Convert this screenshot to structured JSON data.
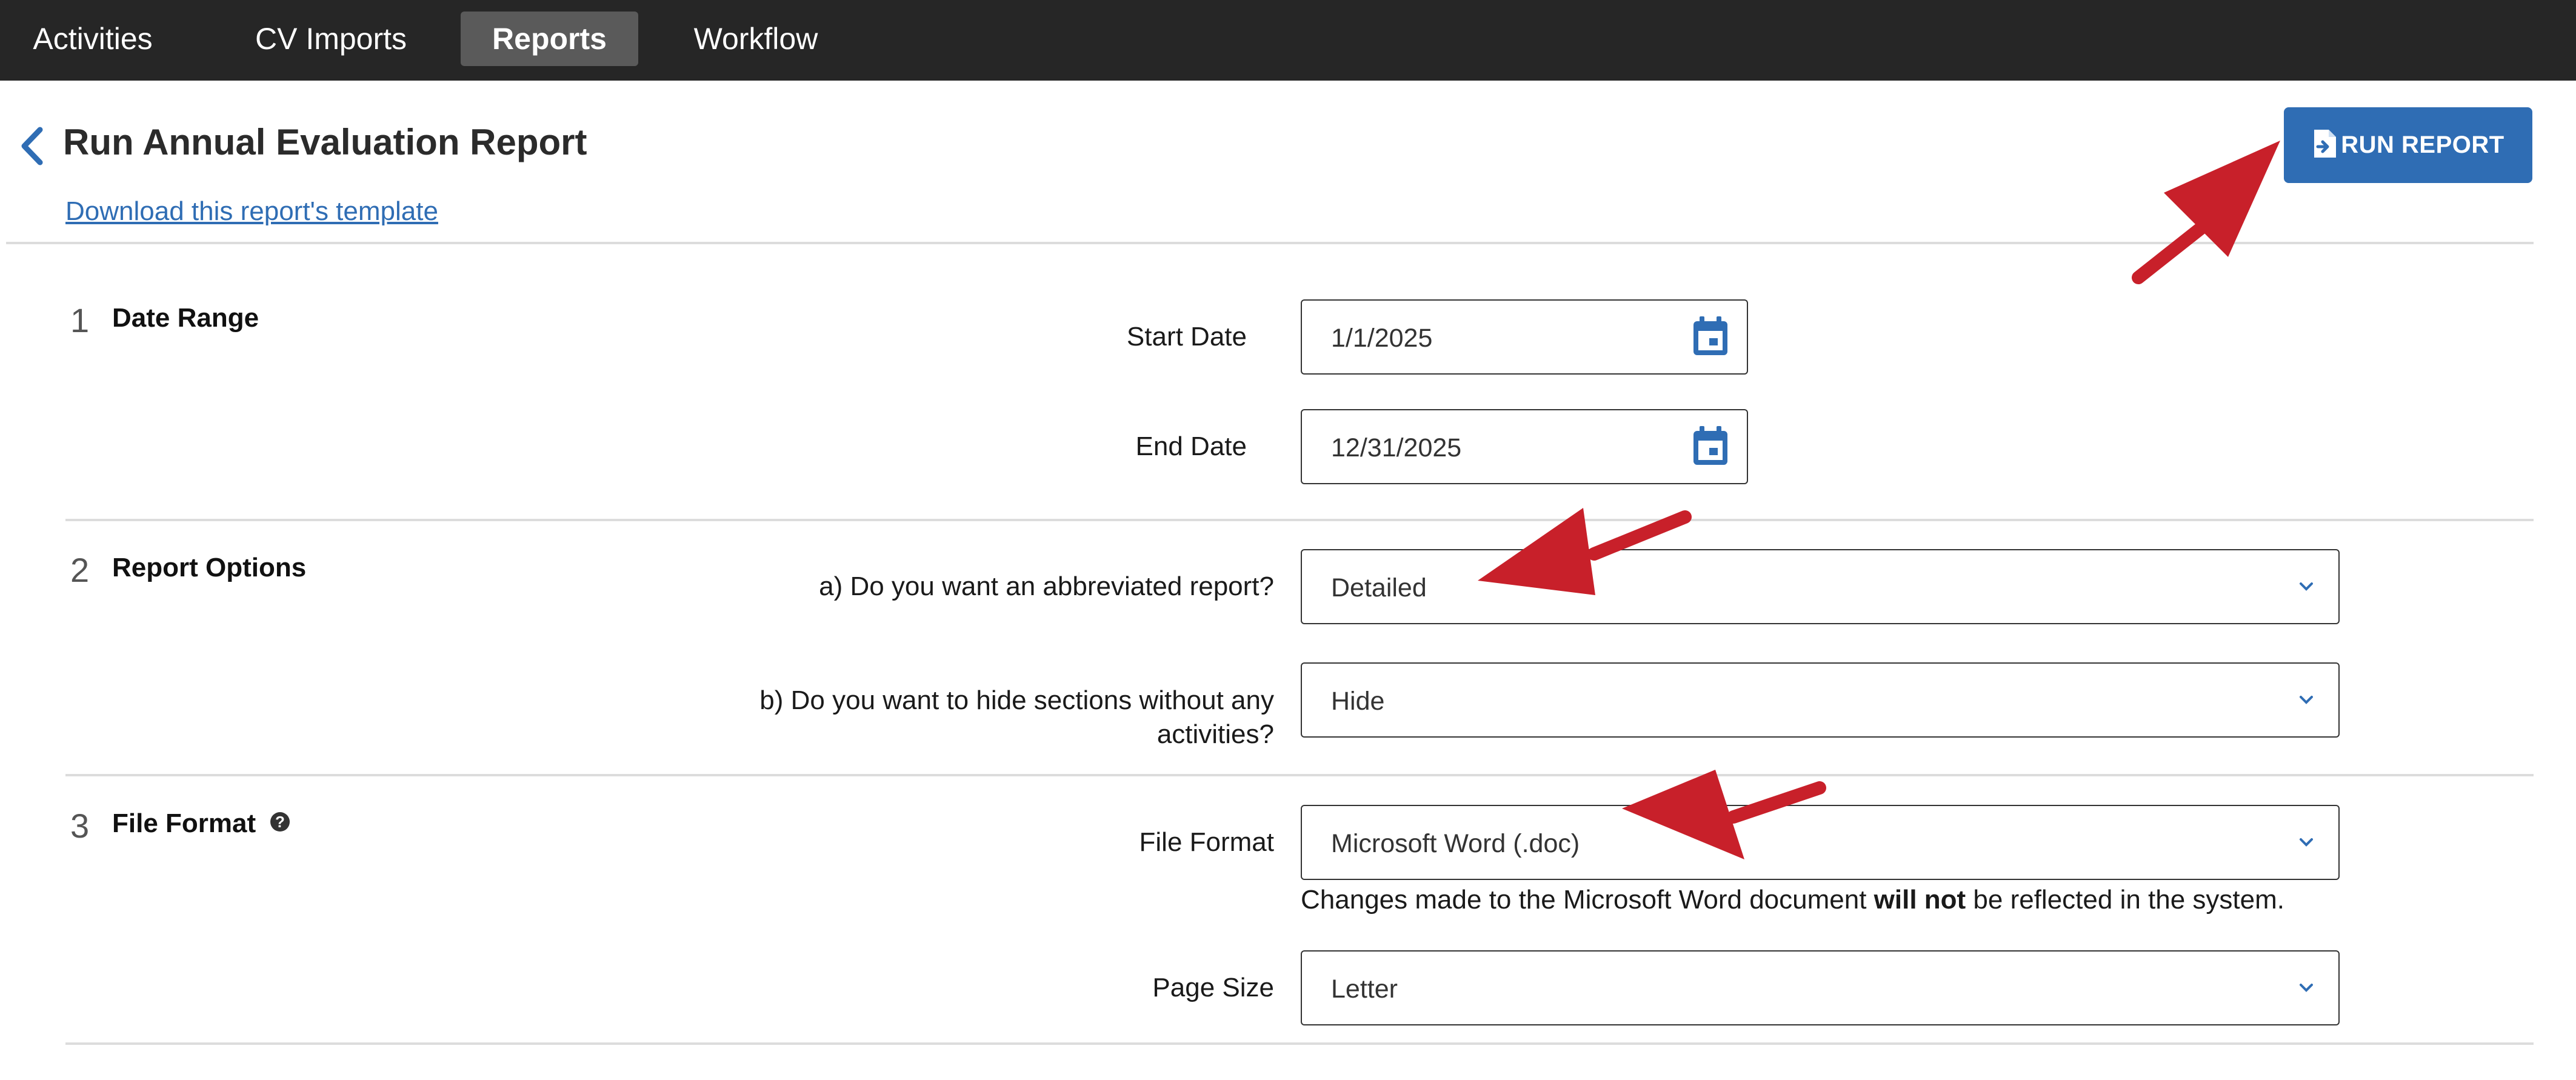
{
  "nav": {
    "tabs": [
      {
        "label": "Activities"
      },
      {
        "label": "CV Imports"
      },
      {
        "label": "Reports",
        "active": true
      },
      {
        "label": "Workflow"
      }
    ]
  },
  "header": {
    "title": "Run Annual Evaluation Report",
    "template_link": "Download this report's template",
    "run_button": "RUN REPORT"
  },
  "sections": [
    {
      "number": "1",
      "title": "Date Range",
      "fields": [
        {
          "label": "Start Date",
          "value": "1/1/2025",
          "icon": "calendar-icon"
        },
        {
          "label": "End Date",
          "value": "12/31/2025",
          "icon": "calendar-icon"
        }
      ]
    },
    {
      "number": "2",
      "title": "Report Options",
      "fields": [
        {
          "label": "a) Do you want an abbreviated report?",
          "value": "Detailed"
        },
        {
          "label_line1": "b) Do you want to hide sections without any",
          "label_line2": "activities?",
          "value": "Hide"
        }
      ]
    },
    {
      "number": "3",
      "title": "File Format",
      "help_icon": "?",
      "fields": [
        {
          "label": "File Format",
          "value": "Microsoft Word (.doc)"
        },
        {
          "label": "Page Size",
          "value": "Letter"
        }
      ],
      "note_pre": "Changes made to the Microsoft Word document ",
      "note_bold": "will not",
      "note_post": " be reflected in the system."
    }
  ],
  "colors": {
    "nav_bg": "#262626",
    "accent": "#2f6db4",
    "annotation_arrow": "#c8202a"
  }
}
